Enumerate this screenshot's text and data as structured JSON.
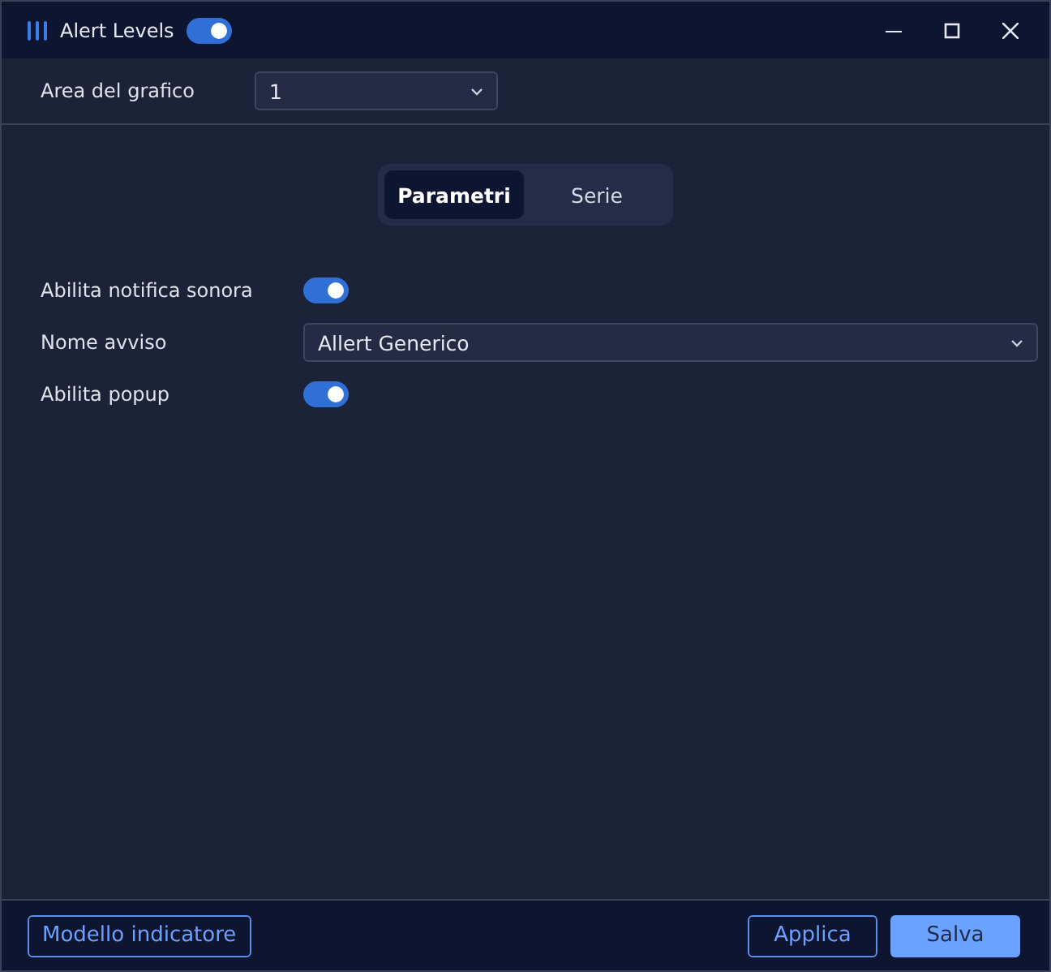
{
  "window": {
    "title": "Alert Levels",
    "enabled": true
  },
  "chart_area": {
    "label": "Area del grafico",
    "value": "1"
  },
  "tabs": [
    {
      "label": "Parametri",
      "selected": true
    },
    {
      "label": "Serie",
      "selected": false
    }
  ],
  "settings": [
    {
      "kind": "toggle",
      "label": "Abilita notifica sonora",
      "on": true
    },
    {
      "kind": "select",
      "label": "Nome avviso",
      "value": "Allert Generico"
    },
    {
      "kind": "toggle",
      "label": "Abilita popup",
      "on": true
    }
  ],
  "footer": {
    "template_button": "Modello indicatore",
    "apply_button": "Applica",
    "save_button": "Salva"
  }
}
